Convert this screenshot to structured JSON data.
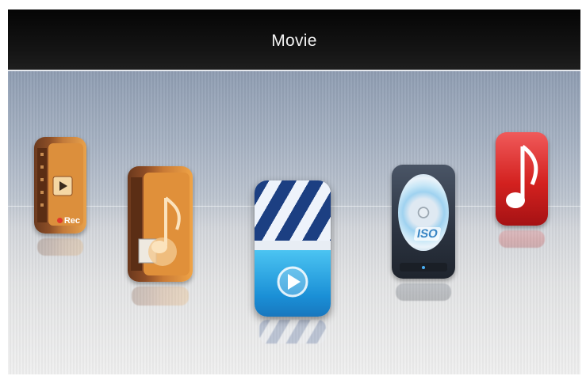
{
  "header": {
    "title": "Movie"
  },
  "apps": [
    {
      "id": "recorded",
      "icon": "recorded-folder-icon",
      "badge_text": "Rec"
    },
    {
      "id": "music-folder",
      "icon": "music-folder-icon"
    },
    {
      "id": "movie",
      "icon": "clapperboard-play-icon"
    },
    {
      "id": "iso",
      "icon": "iso-disc-icon",
      "badge_text": "ISO"
    },
    {
      "id": "music",
      "icon": "music-note-icon"
    }
  ],
  "colors": {
    "header_bg": "#0a0a0a",
    "clapper_blue": "#1c3f82",
    "screen_cyan": "#1a8fd6",
    "folder_orange": "#e9a24b",
    "note_red": "#d3211f"
  }
}
